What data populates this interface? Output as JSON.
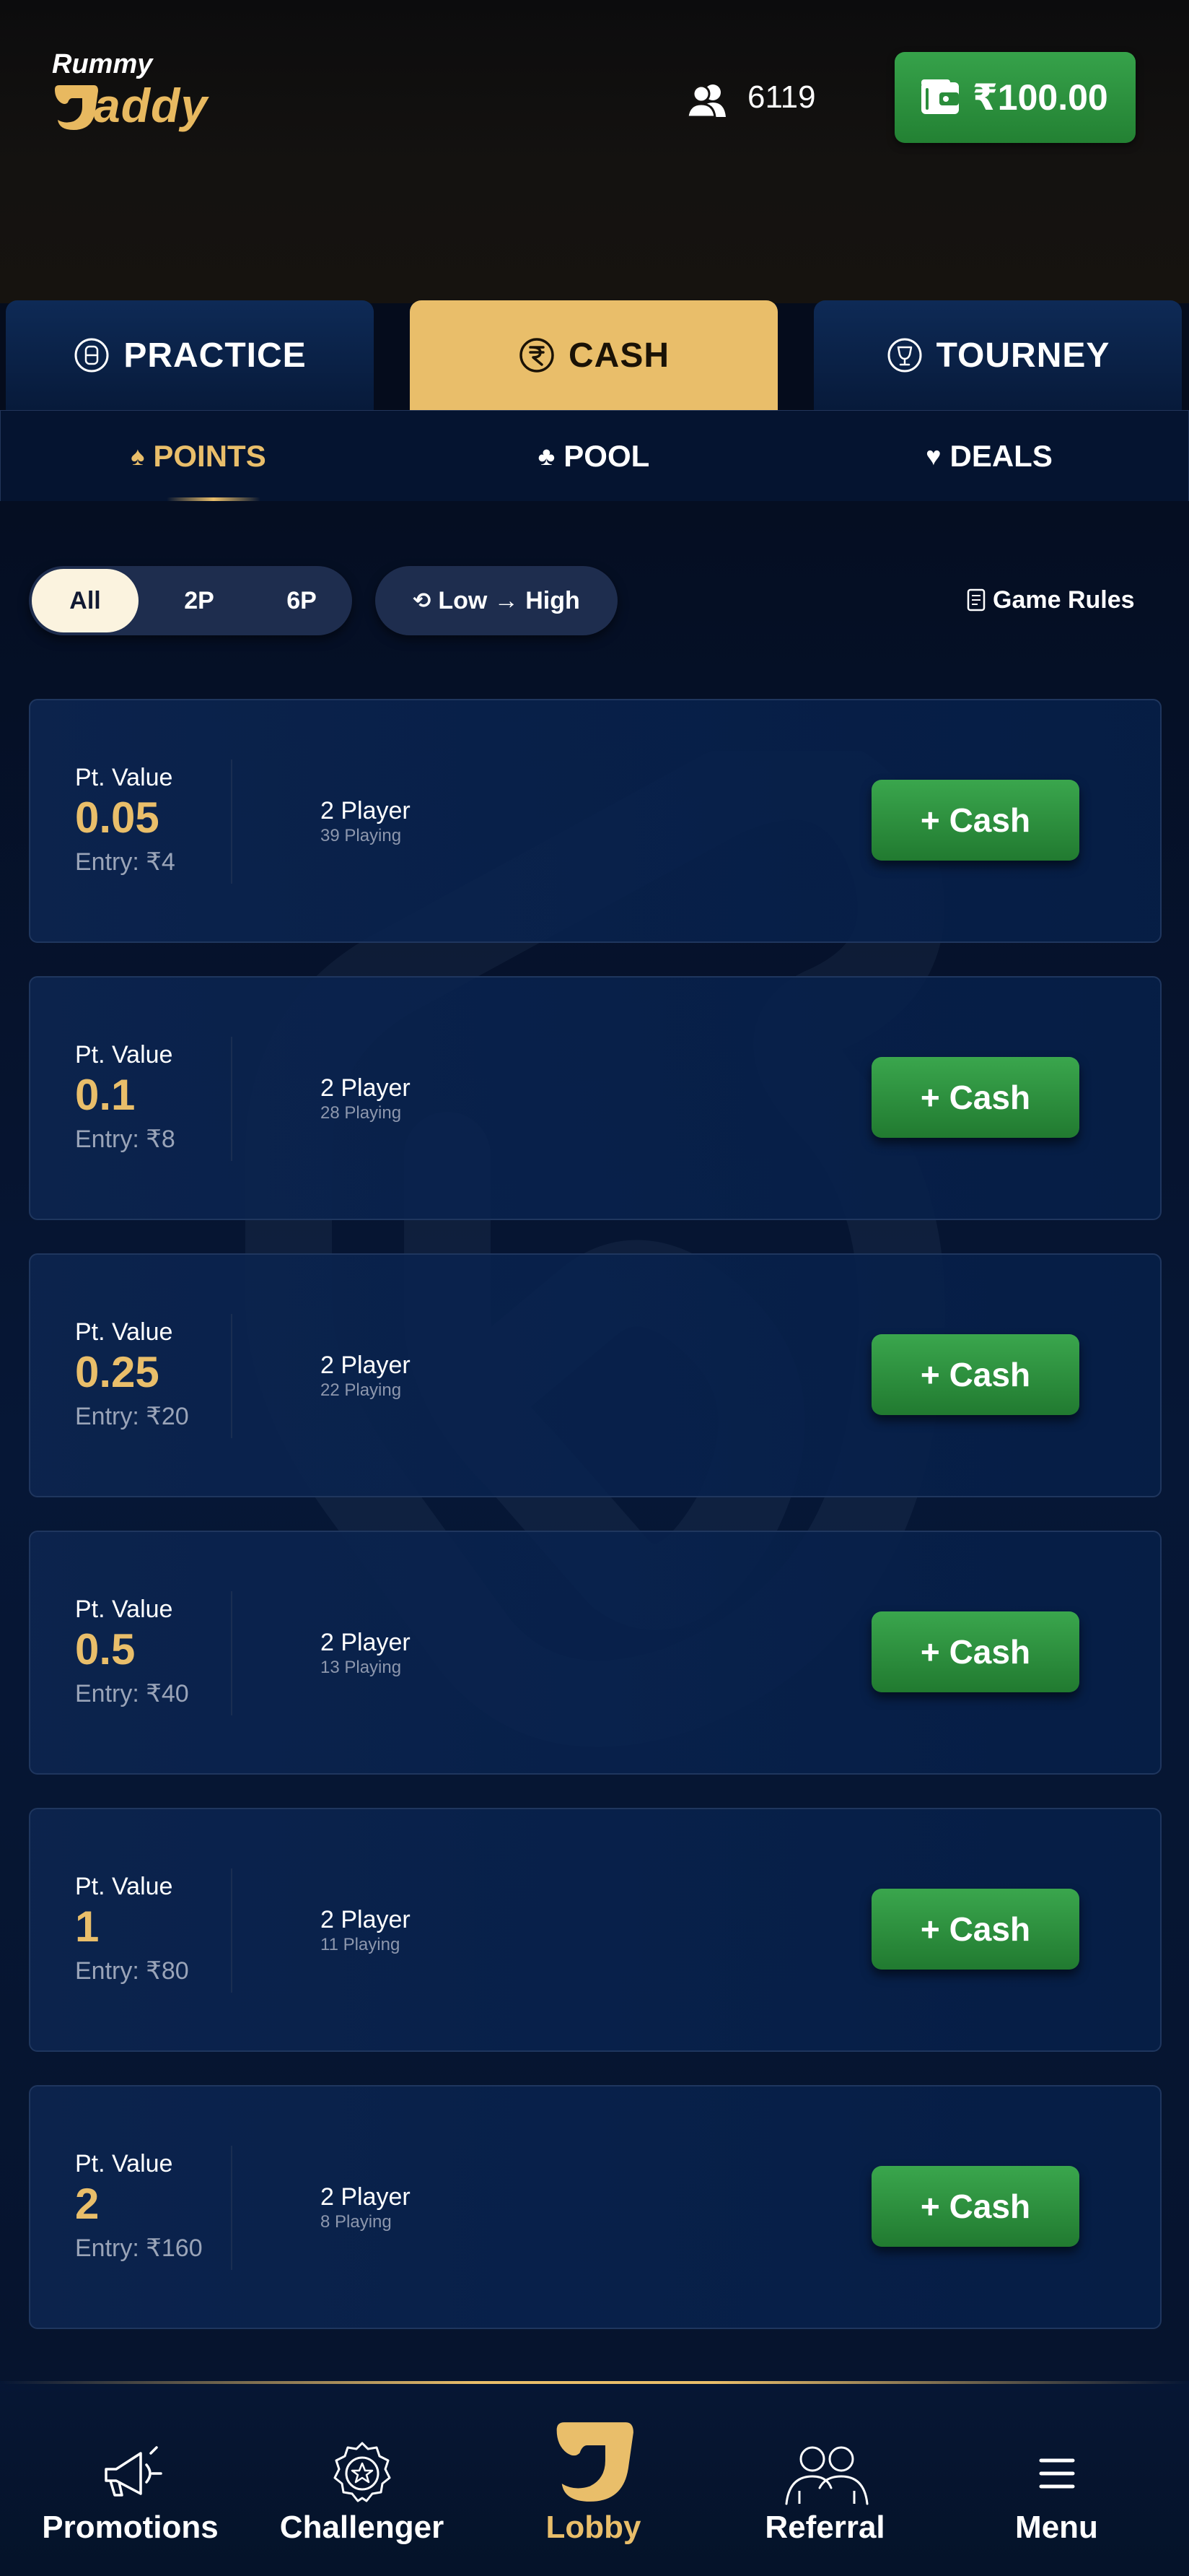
{
  "header": {
    "logo_top": "Rummy",
    "logo_bottom": "addy",
    "online_count": "6119",
    "wallet_amount": "₹100.00"
  },
  "tabs": [
    {
      "label": "PRACTICE",
      "icon": "practice-chip-icon",
      "active": false
    },
    {
      "label": "CASH",
      "icon": "rupee-icon",
      "active": true
    },
    {
      "label": "TOURNEY",
      "icon": "trophy-icon",
      "active": false
    }
  ],
  "subtabs": [
    {
      "label": "POINTS",
      "icon": "spade-icon",
      "active": true
    },
    {
      "label": "POOL",
      "icon": "club-icon",
      "active": false
    },
    {
      "label": "DEALS",
      "icon": "heart-icon",
      "active": false
    }
  ],
  "filters": {
    "player_options": [
      "All",
      "2P",
      "6P"
    ],
    "selected": "All",
    "sort_label": "Low → High",
    "game_rules_label": "Game Rules"
  },
  "tables": [
    {
      "pt_label": "Pt. Value",
      "pt_value": "0.05",
      "entry": "Entry: ₹4",
      "players": "2 Player",
      "playing": "39 Playing",
      "button": "+ Cash"
    },
    {
      "pt_label": "Pt. Value",
      "pt_value": "0.1",
      "entry": "Entry: ₹8",
      "players": "2 Player",
      "playing": "28 Playing",
      "button": "+ Cash"
    },
    {
      "pt_label": "Pt. Value",
      "pt_value": "0.25",
      "entry": "Entry: ₹20",
      "players": "2 Player",
      "playing": "22 Playing",
      "button": "+ Cash"
    },
    {
      "pt_label": "Pt. Value",
      "pt_value": "0.5",
      "entry": "Entry: ₹40",
      "players": "2 Player",
      "playing": "13 Playing",
      "button": "+ Cash"
    },
    {
      "pt_label": "Pt. Value",
      "pt_value": "1",
      "entry": "Entry: ₹80",
      "players": "2 Player",
      "playing": "11 Playing",
      "button": "+ Cash"
    },
    {
      "pt_label": "Pt. Value",
      "pt_value": "2",
      "entry": "Entry: ₹160",
      "players": "2 Player",
      "playing": "8 Playing",
      "button": "+ Cash"
    }
  ],
  "bottom_nav": [
    {
      "label": "Promotions",
      "icon": "megaphone-icon",
      "active": false
    },
    {
      "label": "Challenger",
      "icon": "badge-star-icon",
      "active": false
    },
    {
      "label": "Lobby",
      "icon": "lobby-logo-icon",
      "active": true
    },
    {
      "label": "Referral",
      "icon": "people-icon",
      "active": false
    },
    {
      "label": "Menu",
      "icon": "hamburger-icon",
      "active": false
    }
  ],
  "colors": {
    "gold": "#e9be6a",
    "green": "#2f9a42",
    "navy": "#061736"
  }
}
